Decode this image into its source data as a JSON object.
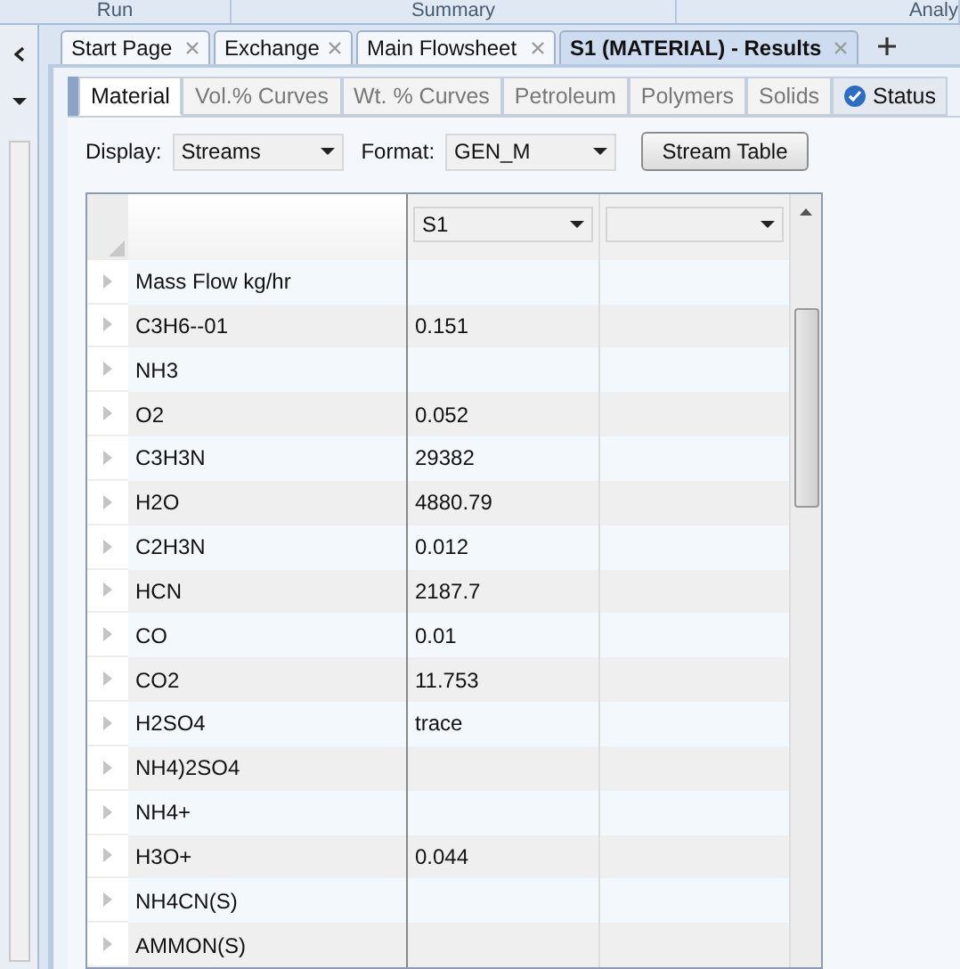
{
  "ribbon": {
    "groups": [
      "Run",
      "Summary",
      "Analy"
    ]
  },
  "document_tabs": [
    {
      "label": "Start Page",
      "selected": false
    },
    {
      "label": "Exchange",
      "selected": false
    },
    {
      "label": "Main Flowsheet",
      "selected": false
    },
    {
      "label": "S1 (MATERIAL) - Results",
      "selected": true
    }
  ],
  "result_tabs": [
    {
      "label": "Material",
      "selected": true,
      "kind": "plain"
    },
    {
      "label": "Vol.% Curves",
      "selected": false,
      "kind": "plain"
    },
    {
      "label": "Wt. % Curves",
      "selected": false,
      "kind": "plain"
    },
    {
      "label": "Petroleum",
      "selected": false,
      "kind": "plain"
    },
    {
      "label": "Polymers",
      "selected": false,
      "kind": "plain"
    },
    {
      "label": "Solids",
      "selected": false,
      "kind": "plain"
    },
    {
      "label": "Status",
      "selected": false,
      "kind": "status"
    }
  ],
  "toolbar": {
    "display_label": "Display:",
    "display_value": "Streams",
    "format_label": "Format:",
    "format_value": "GEN_M",
    "button": "Stream Table"
  },
  "table": {
    "stream_selectors": [
      {
        "kind": "stream",
        "value": "S1"
      },
      {
        "kind": "empty"
      }
    ],
    "rows": [
      {
        "label": "Mass Flow kg/hr"
      },
      {
        "label": "C3H6--01",
        "value": "0.151"
      },
      {
        "label": "NH3"
      },
      {
        "label": "O2",
        "value": "0.052"
      },
      {
        "label": "C3H3N",
        "value": "29382"
      },
      {
        "label": "H2O",
        "value": "4880.79"
      },
      {
        "label": "C2H3N",
        "value": "0.012"
      },
      {
        "label": "HCN",
        "value": "2187.7"
      },
      {
        "label": "CO",
        "value": "0.01"
      },
      {
        "label": "CO2",
        "value": "11.753"
      },
      {
        "label": "H2SO4",
        "value": "trace"
      },
      {
        "label": "NH4)2SO4"
      },
      {
        "label": "NH4+"
      },
      {
        "label": "H3O+",
        "value": "0.044"
      },
      {
        "label": "NH4CN(S)"
      },
      {
        "label": "AMMON(S)"
      }
    ]
  }
}
